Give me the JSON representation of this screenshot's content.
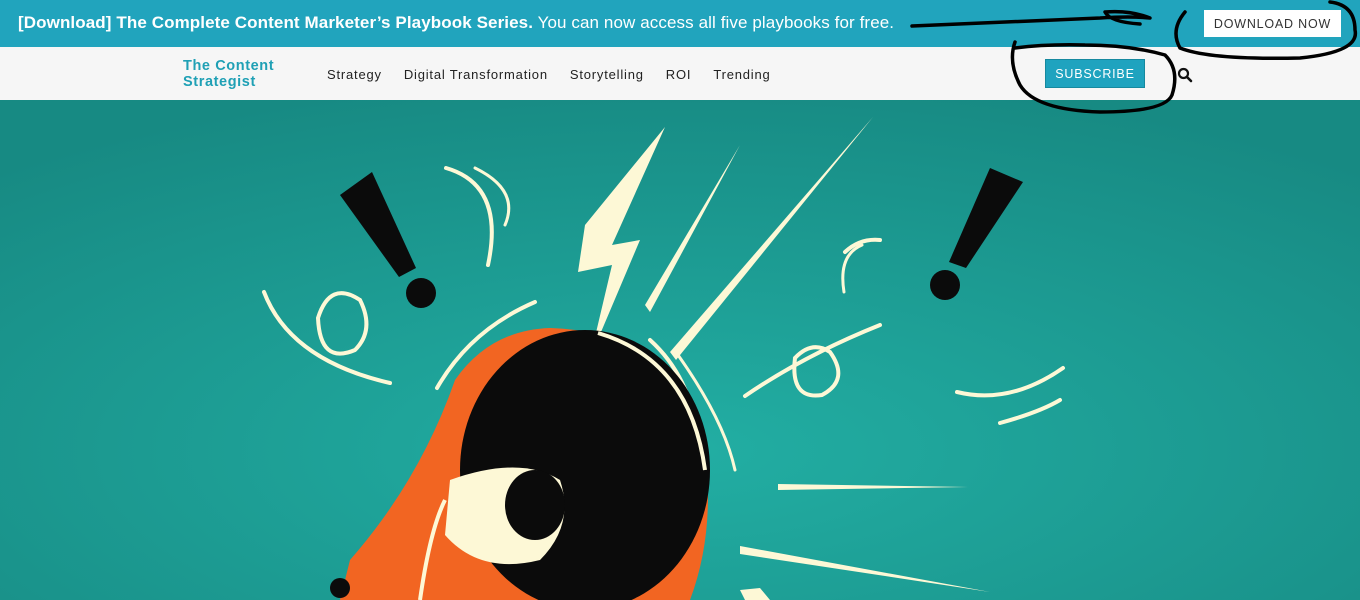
{
  "banner": {
    "bold_text": "[Download] The Complete Content Marketer’s Playbook Series.",
    "text": " You can now access all five playbooks for free.",
    "download_label": "DOWNLOAD NOW"
  },
  "nav": {
    "logo_line1": "The Content",
    "logo_line2": "Strategist",
    "items": [
      {
        "label": "Strategy"
      },
      {
        "label": "Digital Transformation"
      },
      {
        "label": "Storytelling"
      },
      {
        "label": "ROI"
      },
      {
        "label": "Trending"
      }
    ],
    "subscribe_label": "SUBSCRIBE",
    "search_icon": "search-icon"
  },
  "colors": {
    "banner_bg": "#21a4bd",
    "accent": "#1fa3bf",
    "hero_bg": "#1a9a93",
    "megaphone": "#f26522",
    "cream": "#fdf8d6"
  },
  "hero": {
    "illustration": "megaphone-illustration"
  }
}
